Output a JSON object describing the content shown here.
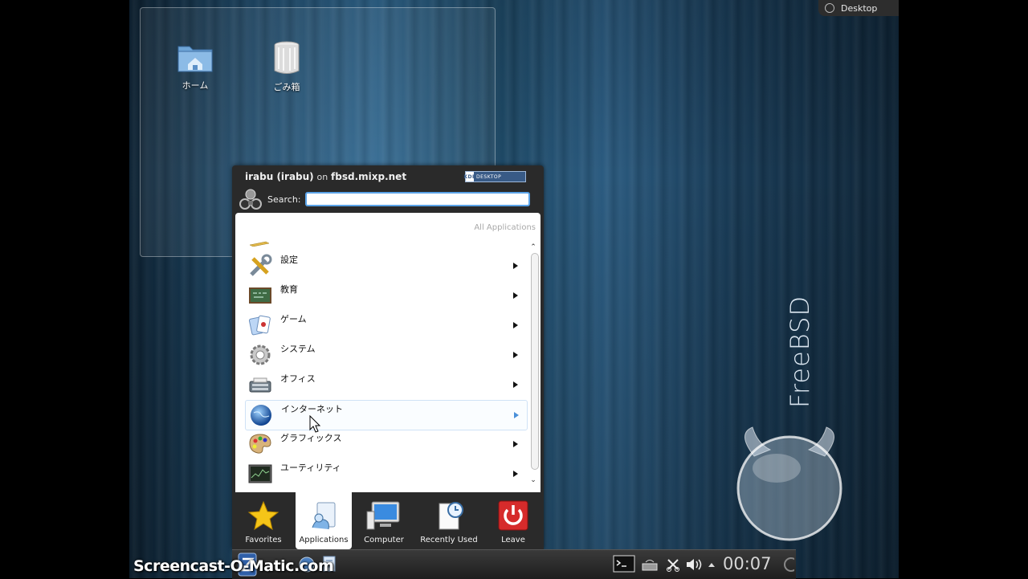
{
  "desktop": {
    "icons": [
      {
        "label": "ホーム",
        "icon": "home-folder-icon"
      },
      {
        "label": "ごみ箱",
        "icon": "trash-icon"
      }
    ],
    "activity_label": "Desktop",
    "wallpaper_text": "FreeBSD"
  },
  "launcher": {
    "user": "irabu (irabu)",
    "on_word": "on",
    "host": "fbsd.mixp.net",
    "badge_kde": "KDE",
    "badge_desktop": "DESKTOP",
    "search_label": "Search:",
    "search_value": "",
    "panel_header": "All Applications",
    "categories": [
      {
        "label": "設定",
        "icon": "settings-icon"
      },
      {
        "label": "教育",
        "icon": "education-icon"
      },
      {
        "label": "ゲーム",
        "icon": "games-icon"
      },
      {
        "label": "システム",
        "icon": "system-icon"
      },
      {
        "label": "オフィス",
        "icon": "office-icon"
      },
      {
        "label": "インターネット",
        "icon": "internet-icon",
        "hovered": true
      },
      {
        "label": "グラフィックス",
        "icon": "graphics-icon"
      },
      {
        "label": "ユーティリティ",
        "icon": "utilities-icon"
      }
    ],
    "tabs": [
      {
        "label": "Favorites",
        "icon": "star-icon",
        "active": false
      },
      {
        "label": "Applications",
        "icon": "applications-icon",
        "active": true
      },
      {
        "label": "Computer",
        "icon": "computer-icon",
        "active": false
      },
      {
        "label": "Recently Used",
        "icon": "recent-icon",
        "active": false
      },
      {
        "label": "Leave",
        "icon": "power-icon",
        "active": false
      }
    ]
  },
  "taskbar": {
    "clock": "00:07",
    "watermark": "Screencast-O-Matic.com"
  },
  "colors": {
    "search_focus": "#5aa3e8",
    "leave_red": "#d62b2b",
    "launcher_bg": "#2a2a2a"
  }
}
